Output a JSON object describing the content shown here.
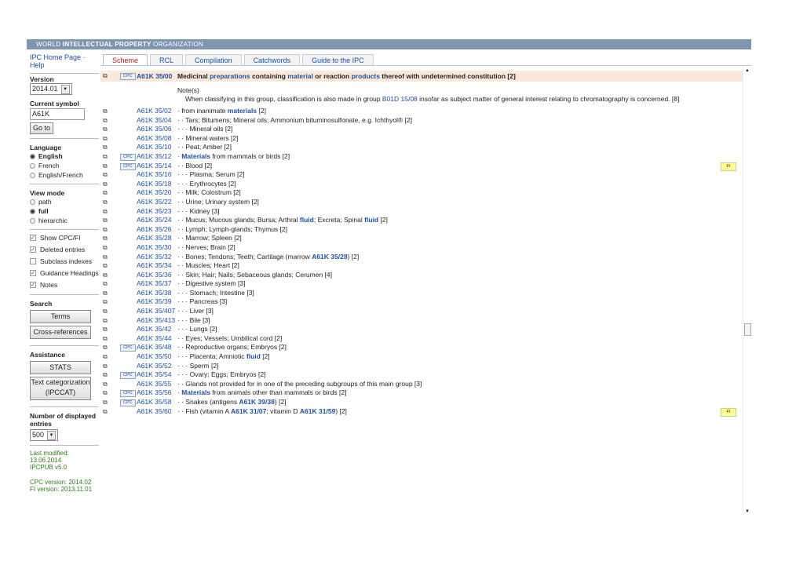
{
  "header": {
    "part1": "WORLD ",
    "part2": "INTELLECTUAL",
    "part3": " PROPERTY",
    "part4": " ORGANIZATION"
  },
  "sidebar": {
    "home_link": "IPC Home Page",
    "sep": "·",
    "help_link": "Help",
    "version_label": "Version",
    "version_value": "2014.01",
    "current_symbol_label": "Current symbol",
    "current_symbol_value": "A61K",
    "goto_label": "Go to",
    "language_label": "Language",
    "languages": [
      "English",
      "French",
      "English/French"
    ],
    "language_selected": 0,
    "viewmode_label": "View mode",
    "viewmodes": [
      "path",
      "full",
      "hierarchic"
    ],
    "viewmode_selected": 1,
    "checks": [
      {
        "label": "Show CPC/FI",
        "checked": true
      },
      {
        "label": "Deleted entries",
        "checked": true
      },
      {
        "label": "Subclass indexes",
        "checked": false
      },
      {
        "label": "Guidance Headings",
        "checked": true
      },
      {
        "label": "Notes",
        "checked": true
      }
    ],
    "search_label": "Search",
    "terms_label": "Terms",
    "crossref_label": "Cross-references",
    "assistance_label": "Assistance",
    "stats_label": "STATS",
    "textcat_label1": "Text categorization",
    "textcat_label2": "(IPCCAT)",
    "num_entries_label": "Number of displayed entries",
    "num_entries_value": "500",
    "last_modified": "Last modified: 13.06.2014",
    "ipcpub": "IPCPUB v5.0",
    "cpc_version": "CPC version: 2014.02",
    "fi_version": "FI version: 2013.11.01"
  },
  "tabs": [
    "Scheme",
    "RCL",
    "Compilation",
    "Catchwords",
    "Guide to the IPC"
  ],
  "active_tab": 0,
  "main_entry": {
    "cpc": "CPC",
    "symbol": "A61K 35/00",
    "t1": "Medicinal ",
    "k1": "preparations",
    "t2": " containing ",
    "k2": "material",
    "t3": " or reaction ",
    "k3": "products",
    "t4": " thereof with undetermined constitution [2]"
  },
  "note": {
    "heading": "Note(s)",
    "text_a": "When classifying in this group, classification is also made in group ",
    "ref": "B01D 15/08",
    "text_b": " insofar as subject matter of general interest relating to chromatography is concerned. [8]"
  },
  "entries": [
    {
      "symbol": "A61K 35/02",
      "cpc": false,
      "fi": false,
      "text": "· from inanimate ",
      "kw": "materials",
      "text2": " [2]"
    },
    {
      "symbol": "A61K 35/04",
      "cpc": false,
      "fi": false,
      "text": "· · Tars; Bitumens; Mineral oils; Ammonium bituminosulfonate, e.g. Ichthyol® [2]"
    },
    {
      "symbol": "A61K 35/06",
      "cpc": false,
      "fi": false,
      "text": "· · · Mineral oils [2]"
    },
    {
      "symbol": "A61K 35/08",
      "cpc": false,
      "fi": false,
      "text": "· · Mineral waters [2]"
    },
    {
      "symbol": "A61K 35/10",
      "cpc": false,
      "fi": false,
      "text": "· · Peat; Amber [2]"
    },
    {
      "symbol": "A61K 35/12",
      "cpc": true,
      "fi": false,
      "text": "· ",
      "kw": "Materials",
      "text2": " from mammals or birds [2]"
    },
    {
      "symbol": "A61K 35/14",
      "cpc": true,
      "fi": true,
      "text": "· · Blood [2]"
    },
    {
      "symbol": "A61K 35/16",
      "cpc": false,
      "fi": false,
      "text": "· · · Plasma; Serum [2]"
    },
    {
      "symbol": "A61K 35/18",
      "cpc": false,
      "fi": false,
      "text": "· · · Erythrocytes [2]"
    },
    {
      "symbol": "A61K 35/20",
      "cpc": false,
      "fi": false,
      "text": "· · Milk; Colostrum [2]"
    },
    {
      "symbol": "A61K 35/22",
      "cpc": false,
      "fi": false,
      "text": "· · Urine; Urinary system [2]"
    },
    {
      "symbol": "A61K 35/23",
      "cpc": false,
      "fi": false,
      "text": "· · · Kidney [3]"
    },
    {
      "symbol": "A61K 35/24",
      "cpc": false,
      "fi": false,
      "text": "· · Mucus; Mucous glands; Bursa; Arthral ",
      "kw": "fluid",
      "text2": "; Excreta; Spinal ",
      "kw2": "fluid",
      "text3": " [2]"
    },
    {
      "symbol": "A61K 35/26",
      "cpc": false,
      "fi": false,
      "text": "· · Lymph; Lymph-glands; Thymus [2]"
    },
    {
      "symbol": "A61K 35/28",
      "cpc": false,
      "fi": false,
      "text": "· · Marrow; Spleen [2]"
    },
    {
      "symbol": "A61K 35/30",
      "cpc": false,
      "fi": false,
      "text": "· · Nerves; Brain [2]"
    },
    {
      "symbol": "A61K 35/32",
      "cpc": false,
      "fi": false,
      "text": "· · Bones; Tendons; Teeth; Cartilage (marrow ",
      "kw": "A61K 35/28",
      "text2": ") [2]"
    },
    {
      "symbol": "A61K 35/34",
      "cpc": false,
      "fi": false,
      "text": "· · Muscles; Heart [2]"
    },
    {
      "symbol": "A61K 35/36",
      "cpc": false,
      "fi": false,
      "text": "· · Skin; Hair; Nails; Sebaceous glands; Cerumen [4]"
    },
    {
      "symbol": "A61K 35/37",
      "cpc": false,
      "fi": false,
      "text": "· · Digestive system [3]"
    },
    {
      "symbol": "A61K 35/38",
      "cpc": false,
      "fi": false,
      "text": "· · · Stomach; Intestine [3]"
    },
    {
      "symbol": "A61K 35/39",
      "cpc": false,
      "fi": false,
      "text": "· · · Pancreas [3]"
    },
    {
      "symbol": "A61K 35/407",
      "cpc": false,
      "fi": false,
      "text": "· · · Liver [3]"
    },
    {
      "symbol": "A61K 35/413",
      "cpc": false,
      "fi": false,
      "text": "· · · Bile [3]"
    },
    {
      "symbol": "A61K 35/42",
      "cpc": false,
      "fi": false,
      "text": "· · · Lungs [2]"
    },
    {
      "symbol": "A61K 35/44",
      "cpc": false,
      "fi": false,
      "text": "· · Eyes; Vessels; Umbilical cord [2]"
    },
    {
      "symbol": "A61K 35/48",
      "cpc": true,
      "fi": false,
      "text": "· · Reproductive organs; Embryos [2]"
    },
    {
      "symbol": "A61K 35/50",
      "cpc": false,
      "fi": false,
      "text": "· · · Placenta; Amniotic ",
      "kw": "fluid",
      "text2": " [2]"
    },
    {
      "symbol": "A61K 35/52",
      "cpc": false,
      "fi": false,
      "text": "· · · Sperm [2]"
    },
    {
      "symbol": "A61K 35/54",
      "cpc": true,
      "fi": false,
      "text": "· · · Ovary; Eggs; Embryos [2]"
    },
    {
      "symbol": "A61K 35/55",
      "cpc": false,
      "fi": false,
      "text": "· · Glands not provided for in one of the preceding subgroups of this main group [3]"
    },
    {
      "symbol": "A61K 35/56",
      "cpc": true,
      "fi": false,
      "text": "· ",
      "kw": "Materials",
      "text2": " from animals other than mammals or birds [2]"
    },
    {
      "symbol": "A61K 35/58",
      "cpc": true,
      "fi": false,
      "text": "· · Snakes (antigens ",
      "kw": "A61K 39/38",
      "text2": ") [2]"
    },
    {
      "symbol": "A61K 35/60",
      "cpc": false,
      "fi": true,
      "text": "· · Fish (vitamin A ",
      "kw": "A61K 31/07",
      "text2": "; vitamin D ",
      "kw2": "A61K 31/59",
      "text3": ") [2]"
    }
  ],
  "labels": {
    "cpc_badge": "CPC",
    "fi_badge": "FI",
    "ext_icon": "⧉",
    "scroll_up": "▲",
    "scroll_down": "▼"
  }
}
